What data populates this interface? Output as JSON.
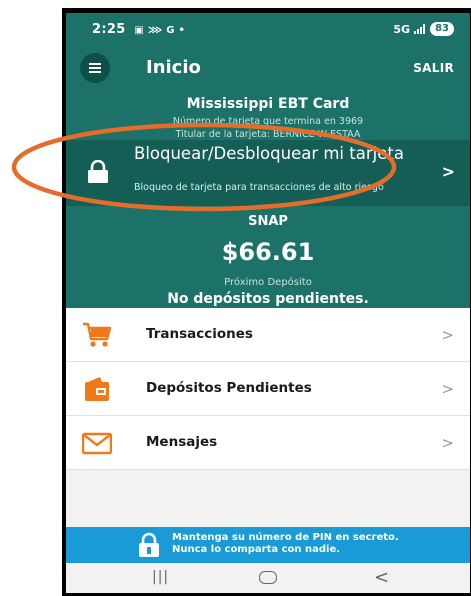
{
  "status_bar": {
    "time": "2:25",
    "notif_icons": "▣ ⋙ G  •",
    "network": "5G",
    "battery": "83"
  },
  "header": {
    "title": "Inicio",
    "logout_label": "SALIR"
  },
  "card": {
    "name": "Mississippi EBT Card",
    "number_text": "Número de tarjeta que termina en 3969",
    "holder_text": "Titular de la tarjeta: BERNICE W ESTAA"
  },
  "lock_card": {
    "title": "Bloquear/Desbloquear mi tarjeta",
    "subtitle": "Bloqueo de tarjeta para transacciones de alto riesgo"
  },
  "balance": {
    "program": "SNAP",
    "amount": "$66.61",
    "next_deposit_label": "Próximo Depósito",
    "next_deposit_value": "No depósitos pendientes."
  },
  "menu": {
    "items": [
      {
        "label": "Transacciones",
        "icon": "shopping-cart-icon"
      },
      {
        "label": "Depósitos Pendientes",
        "icon": "wallet-icon"
      },
      {
        "label": "Mensajes",
        "icon": "envelope-icon"
      }
    ]
  },
  "pin_notice": {
    "line1": "Mantenga su número de PIN en secreto.",
    "line2": "Nunca lo comparta con nadie."
  },
  "colors": {
    "header_teal": "#1c7268",
    "lock_row_teal": "#145e56",
    "accent_orange": "#f07a1a",
    "pin_bar_blue": "#1a9ad6",
    "annotation_orange": "#e46d2b"
  }
}
